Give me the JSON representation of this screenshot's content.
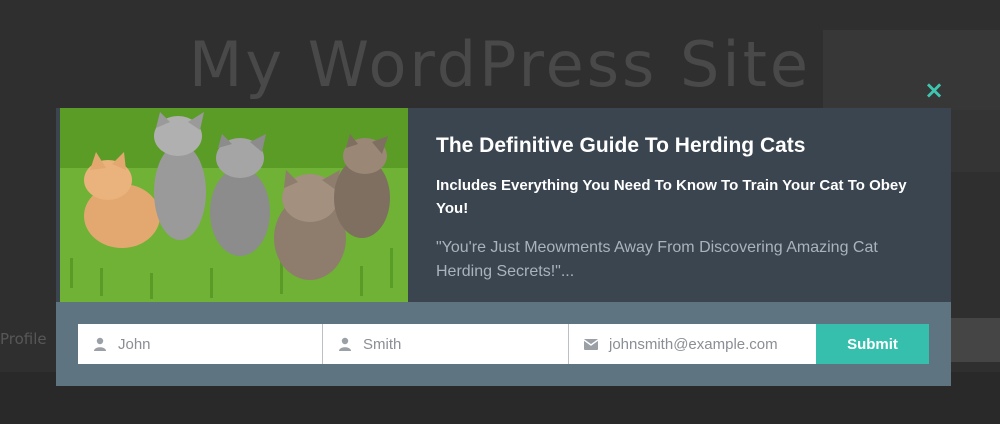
{
  "background_site": {
    "title": "My WordPress Site",
    "nav_label": "Profile"
  },
  "popup": {
    "close_label": "×",
    "image_alt": "kittens-on-grass",
    "headline": "The Definitive Guide To Herding Cats",
    "subheadline": "Includes Everything You Need To Know To Train Your Cat To Obey You!",
    "quote": "\"You're Just Meowments Away From Discovering Amazing Cat Herding Secrets!\"...",
    "form": {
      "first_name_value": "John",
      "last_name_value": "Smith",
      "email_value": "johnsmith@example.com",
      "submit_label": "Submit"
    },
    "colors": {
      "accent": "#35bfac",
      "popup_bg": "#3a4550",
      "form_bar_bg": "#5f7481"
    }
  }
}
